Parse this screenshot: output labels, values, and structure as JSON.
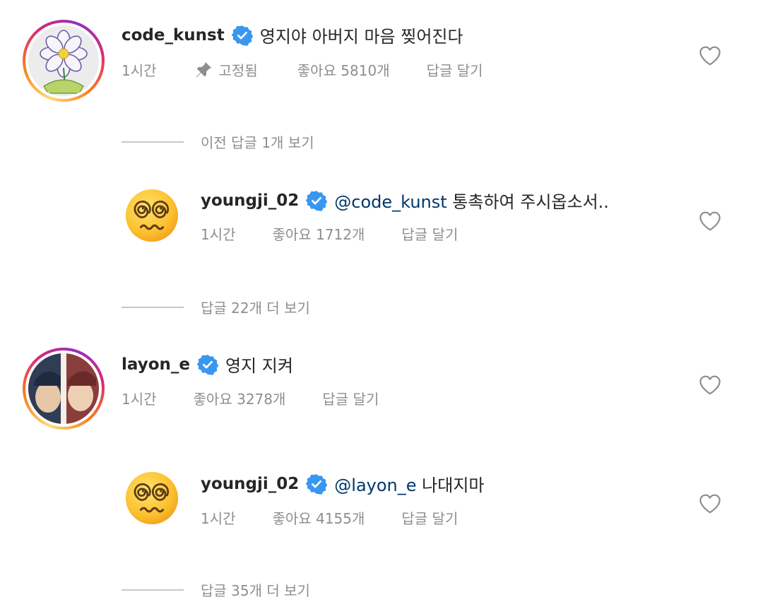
{
  "comments": [
    {
      "username": "code_kunst",
      "verified": true,
      "text": "영지야 아버지 마음 찢어진다",
      "time": "1시간",
      "pinned_label": "고정됨",
      "likes": "좋아요 5810개",
      "reply": "답글 달기",
      "avatar_icon": "flower-drawing-avatar"
    },
    {
      "username": "youngji_02",
      "verified": true,
      "mention": "@code_kunst",
      "text": "통촉하여 주시옵소서..",
      "time": "1시간",
      "likes": "좋아요 1712개",
      "reply": "답글 달기",
      "avatar_icon": "dizzy-face-emoji"
    },
    {
      "username": "layon_e",
      "verified": true,
      "text": "영지 지켜",
      "time": "1시간",
      "likes": "좋아요 3278개",
      "reply": "답글 달기",
      "avatar_icon": "photo-avatar"
    },
    {
      "username": "youngji_02",
      "verified": true,
      "mention": "@layon_e",
      "text": "나대지마",
      "time": "1시간",
      "likes": "좋아요 4155개",
      "reply": "답글 달기",
      "avatar_icon": "dizzy-face-emoji"
    }
  ],
  "threads": [
    "이전 답글 1개 보기",
    "답글 22개 더 보기",
    "답글 35개 더 보기"
  ],
  "colors": {
    "verified_blue": "#3897f0",
    "meta_gray": "#8e8e8e",
    "mention_blue": "#00376b"
  }
}
